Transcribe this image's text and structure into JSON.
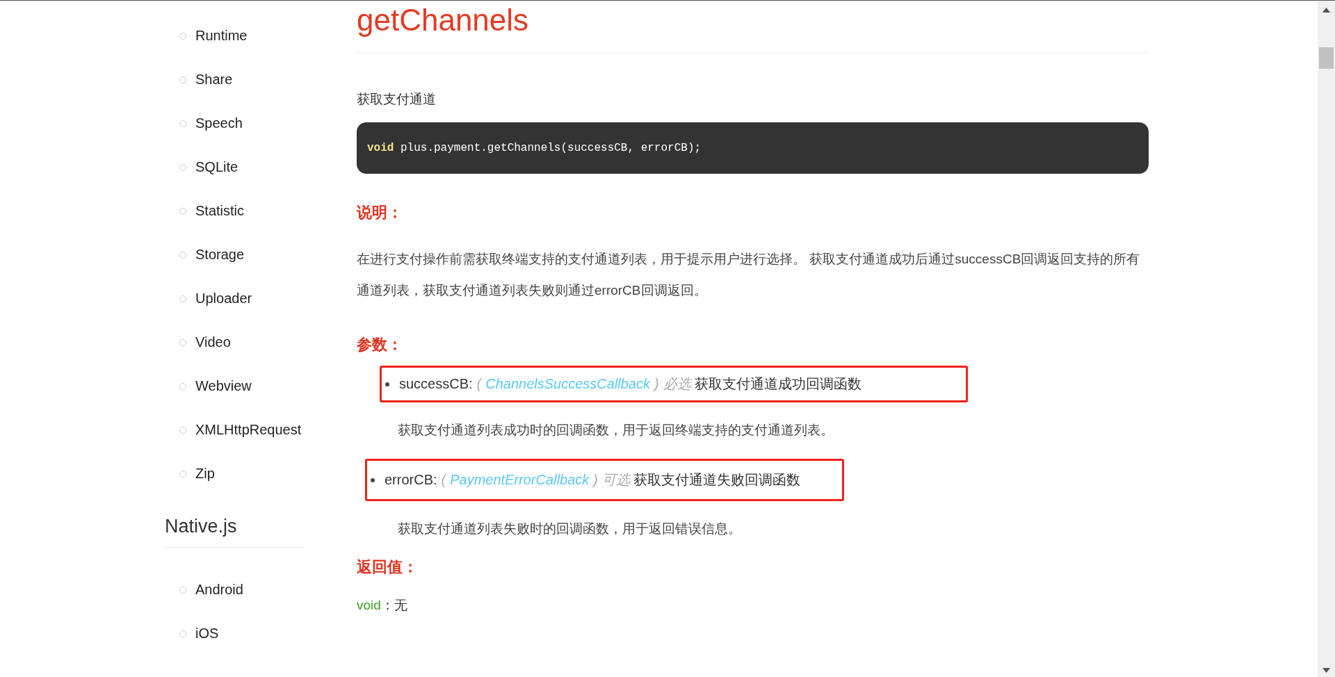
{
  "sidebar": {
    "items": [
      {
        "label": "Runtime"
      },
      {
        "label": "Share"
      },
      {
        "label": "Speech"
      },
      {
        "label": "SQLite"
      },
      {
        "label": "Statistic"
      },
      {
        "label": "Storage"
      },
      {
        "label": "Uploader"
      },
      {
        "label": "Video"
      },
      {
        "label": "Webview"
      },
      {
        "label": "XMLHttpRequest"
      },
      {
        "label": "Zip"
      }
    ],
    "section": {
      "title": "Native.js",
      "items": [
        {
          "label": "Android"
        },
        {
          "label": "iOS"
        }
      ]
    }
  },
  "main": {
    "title": "getChannels",
    "summary": "获取支付通道",
    "code": [
      {
        "kind": "keyword",
        "text": "void"
      },
      {
        "kind": "plain",
        "text": " plus.payment.getChannels(successCB, errorCB);"
      }
    ],
    "description_heading": "说明：",
    "description": "在进行支付操作前需获取终端支持的支付通道列表，用于提示用户进行选择。 获取支付通道成功后通过successCB回调返回支持的所有通道列表，获取支付通道列表失败则通过errorCB回调返回。",
    "params_heading": "参数：",
    "params": [
      {
        "name": "successCB:",
        "paren_open": "(",
        "type": "ChannelsSuccessCallback",
        "paren_close": ")",
        "requirement": "必选",
        "summary": "获取支付通道成功回调函数",
        "description": "获取支付通道列表成功时的回调函数，用于返回终端支持的支付通道列表。",
        "highlighted": true
      },
      {
        "name": "errorCB:",
        "paren_open": "(",
        "type": "PaymentErrorCallback",
        "paren_close": ")",
        "requirement": "可选",
        "summary": "获取支付通道失败回调函数",
        "description": "获取支付通道列表失败时的回调函数，用于返回错误信息。",
        "highlighted": true
      }
    ],
    "returns_heading": "返回值：",
    "returns": {
      "type": "void",
      "text": "：无"
    }
  }
}
